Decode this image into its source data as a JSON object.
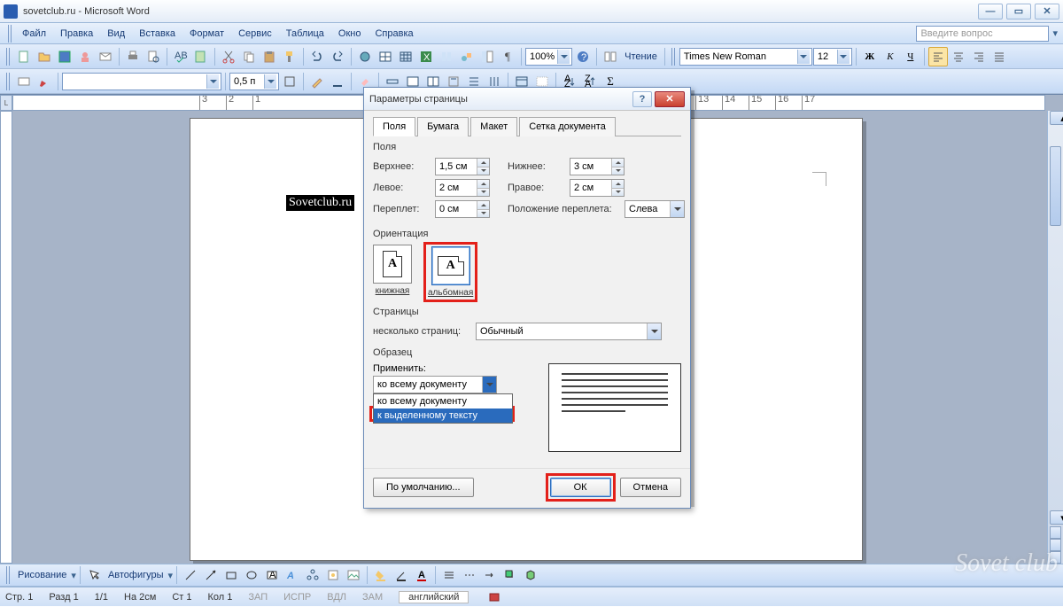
{
  "titlebar": {
    "title": "sovetclub.ru - Microsoft Word"
  },
  "menu": {
    "file": "Файл",
    "edit": "Правка",
    "view": "Вид",
    "insert": "Вставка",
    "format": "Формат",
    "tools": "Сервис",
    "table": "Таблица",
    "window": "Окно",
    "help": "Справка",
    "ask_placeholder": "Введите вопрос"
  },
  "toolbar": {
    "zoom": "100%",
    "reading": "Чтение",
    "font": "Times New Roman",
    "font_size": "12",
    "line_spacing": "0,5 п",
    "bold": "Ж",
    "italic": "К",
    "underline": "Ч"
  },
  "doc": {
    "selected_text": "Sovetclub.ru"
  },
  "bottom": {
    "draw": "Рисование",
    "autoshapes": "Автофигуры"
  },
  "status": {
    "page": "Стр. 1",
    "section": "Разд 1",
    "pages": "1/1",
    "at": "На 2см",
    "line": "Ст 1",
    "col": "Кол 1",
    "rec": "ЗАП",
    "trk": "ИСПР",
    "ext": "ВДЛ",
    "ovr": "ЗАМ",
    "lang": "английский"
  },
  "dialog": {
    "title": "Параметры страницы",
    "tabs": {
      "fields": "Поля",
      "paper": "Бумага",
      "layout": "Макет",
      "grid": "Сетка документа"
    },
    "margins": {
      "label": "Поля",
      "top_l": "Верхнее:",
      "top_v": "1,5 см",
      "bottom_l": "Нижнее:",
      "bottom_v": "3 см",
      "left_l": "Левое:",
      "left_v": "2 см",
      "right_l": "Правое:",
      "right_v": "2 см",
      "gutter_l": "Переплет:",
      "gutter_v": "0 см",
      "gutter_pos_l": "Положение переплета:",
      "gutter_pos_v": "Слева"
    },
    "orientation": {
      "label": "Ориентация",
      "portrait": "книжная",
      "landscape": "альбомная"
    },
    "pages": {
      "label": "Страницы",
      "multi_l": "несколько страниц:",
      "multi_v": "Обычный"
    },
    "sample": {
      "label": "Образец",
      "apply_l": "Применить:",
      "apply_v": "ко всему документу",
      "opt1": "ко всему документу",
      "opt2": "к выделенному тексту"
    },
    "buttons": {
      "default": "По умолчанию...",
      "ok": "ОК",
      "cancel": "Отмена"
    }
  },
  "watermark": "Sovet club"
}
